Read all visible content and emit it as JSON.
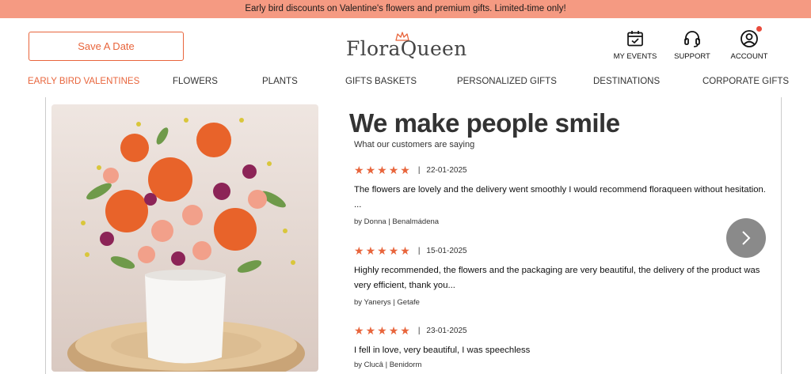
{
  "promo": {
    "text": "Early bird discounts on Valentine's flowers and premium gifts. Limited-time only!"
  },
  "header": {
    "save_date_label": "Save A Date",
    "logo_text": "FloraQueen",
    "icons": {
      "events": {
        "label": "MY EVENTS",
        "icon": "calendar-check-icon"
      },
      "support": {
        "label": "SUPPORT",
        "icon": "headset-icon"
      },
      "account": {
        "label": "ACCOUNT",
        "icon": "user-icon"
      }
    }
  },
  "nav": {
    "items": [
      {
        "label": "EARLY BIRD VALENTINES",
        "active": true
      },
      {
        "label": "FLOWERS"
      },
      {
        "label": "PLANTS"
      },
      {
        "label": "GIFTS BASKETS"
      },
      {
        "label": "PERSONALIZED GIFTS"
      },
      {
        "label": "DESTINATIONS"
      },
      {
        "label": "CORPORATE GIFTS"
      }
    ]
  },
  "reviews": {
    "title": "We make people smile",
    "subtitle": "What our customers are saying",
    "items": [
      {
        "stars": 5,
        "date": "22-01-2025",
        "text_line1": "The flowers are lovely and the delivery went smoothly I would recommend floraqueen without hesitation.",
        "text_line2": "...",
        "author": "by Donna | Benalmádena"
      },
      {
        "stars": 5,
        "date": "15-01-2025",
        "text_line1": "Highly recommended, the flowers and the packaging are very beautiful, the delivery of the product was",
        "text_line2": "very efficient, thank you...",
        "author": "by Yanerys | Getafe"
      },
      {
        "stars": 5,
        "date": "23-01-2025",
        "text_line1": "I fell in love, very beautiful, I was speechless",
        "text_line2": "",
        "author": "by Clucâ | Benidorm"
      }
    ],
    "star_glyph": "★",
    "separator": "|"
  },
  "colors": {
    "accent": "#e8653c",
    "promo_bg": "#f59a82",
    "next_btn": "#8a8a8a"
  }
}
